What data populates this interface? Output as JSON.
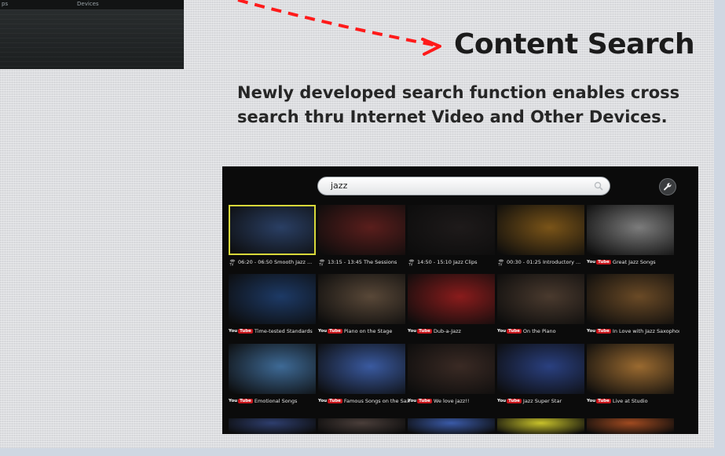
{
  "slide": {
    "title": "Content Search",
    "description": "Newly developed search function enables cross search  thru Internet Video and Other Devices."
  },
  "previous_screenshot": {
    "tabs": [
      "ps",
      "Devices"
    ]
  },
  "tv_ui": {
    "search": {
      "value": "jazz",
      "icon": "search-icon"
    },
    "tools_icon": "wrench-icon",
    "source_badges": {
      "tv": "tv-broadcast-icon",
      "youtube_prefix": "You",
      "youtube_tube": "Tube"
    },
    "tiles": [
      {
        "source": "tv",
        "title": "06:20 - 06:50 Smooth Jazz ...",
        "selected": true,
        "thumb": "#2a3f64"
      },
      {
        "source": "tv",
        "title": "13:15 - 13:45 The Sessions",
        "selected": false,
        "thumb": "#5a1e1c"
      },
      {
        "source": "tv",
        "title": "14:50 - 15:10 Jazz Clips",
        "selected": false,
        "thumb": "#1e1a1a"
      },
      {
        "source": "tv",
        "title": "00:30 - 01:25 Introductory ...",
        "selected": false,
        "thumb": "#7a5418"
      },
      {
        "source": "youtube",
        "title": "Great Jazz Songs",
        "selected": false,
        "thumb": "#7c7c7c"
      },
      {
        "source": "youtube",
        "title": "Time-tested Standards",
        "selected": false,
        "thumb": "#1d3a66"
      },
      {
        "source": "youtube",
        "title": "Piano on the Stage",
        "selected": false,
        "thumb": "#594838"
      },
      {
        "source": "youtube",
        "title": "Dub-a-Jazz",
        "selected": false,
        "thumb": "#8a1c1c"
      },
      {
        "source": "youtube",
        "title": "On the Piano",
        "selected": false,
        "thumb": "#4a3a2e"
      },
      {
        "source": "youtube",
        "title": "In Love with Jazz Saxophonist",
        "selected": false,
        "thumb": "#6a4a26"
      },
      {
        "source": "youtube",
        "title": "Emotional Songs",
        "selected": false,
        "thumb": "#3e6a96"
      },
      {
        "source": "youtube",
        "title": "Famous Songs on the Sax",
        "selected": false,
        "thumb": "#3a5aa0"
      },
      {
        "source": "youtube",
        "title": "We love jazz!!",
        "selected": false,
        "thumb": "#3a2a24"
      },
      {
        "source": "youtube",
        "title": "Jazz Super Star",
        "selected": false,
        "thumb": "#2a4080"
      },
      {
        "source": "youtube",
        "title": "Live at Studio",
        "selected": false,
        "thumb": "#9a6a30"
      }
    ],
    "partial_row_thumbs": [
      "#2e3e6e",
      "#4a3e3a",
      "#3a5aa8",
      "#c8c22a",
      "#a04a20"
    ]
  },
  "colors": {
    "arrow": "#ff1a1a",
    "selection_border": "#d8d83a",
    "youtube_red": "#c8151b"
  }
}
